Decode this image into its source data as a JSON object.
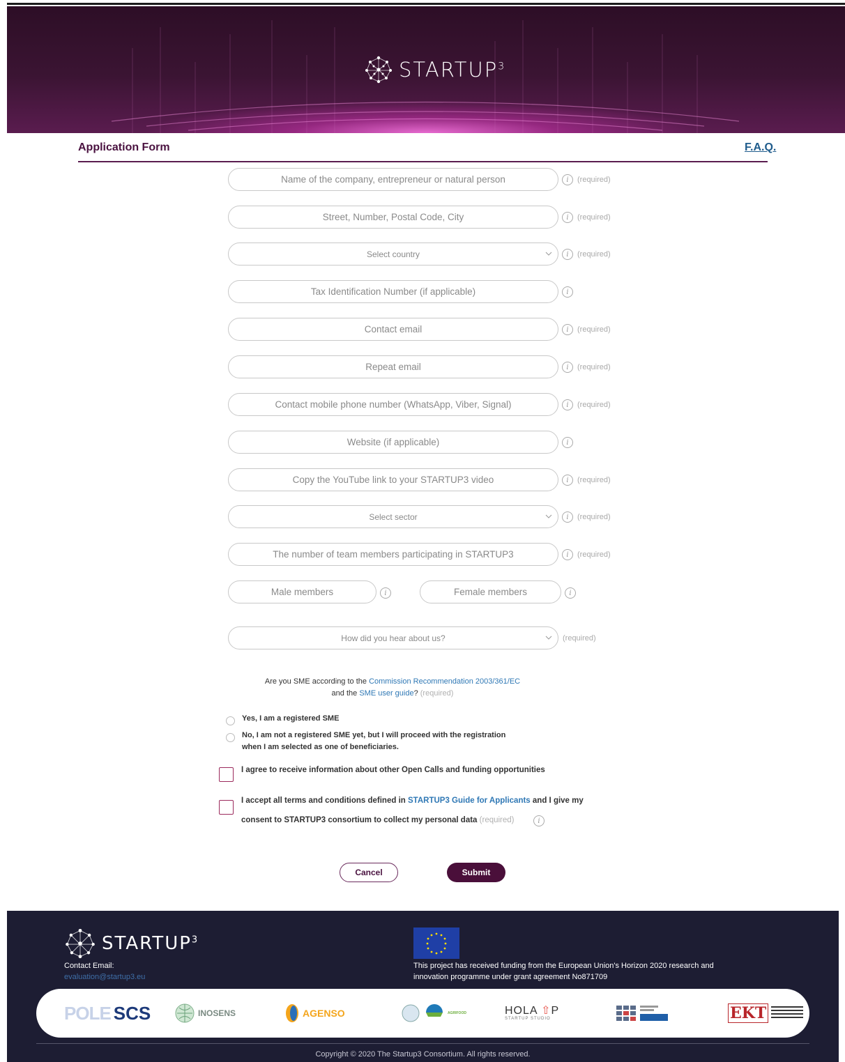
{
  "hero": {
    "brand": "STARTUP",
    "brand_sup": "3"
  },
  "header": {
    "title": "Application Form",
    "faq": "F.A.Q."
  },
  "fields": {
    "company": {
      "placeholder": "Name of the company, entrepreneur or natural person",
      "required": "(required)"
    },
    "address": {
      "placeholder": "Street, Number, Postal Code, City",
      "required": "(required)"
    },
    "country": {
      "placeholder": "Select country",
      "required": "(required)"
    },
    "tax": {
      "placeholder": "Tax Identification Number (if applicable)"
    },
    "email": {
      "placeholder": "Contact email",
      "required": "(required)"
    },
    "repeat_email": {
      "placeholder": "Repeat email",
      "required": "(required)"
    },
    "phone": {
      "placeholder": "Contact mobile phone number (WhatsApp, Viber, Signal)",
      "required": "(required)"
    },
    "website": {
      "placeholder": "Website (if applicable)"
    },
    "youtube": {
      "placeholder": "Copy the YouTube link to your STARTUP3 video",
      "required": "(required)"
    },
    "sector": {
      "placeholder": "Select sector",
      "required": "(required)"
    },
    "team": {
      "placeholder": "The number of team members participating in STARTUP3",
      "required": "(required)"
    },
    "male": {
      "placeholder": "Male members"
    },
    "female": {
      "placeholder": "Female members"
    },
    "hear": {
      "placeholder": "How did you hear about us?",
      "required": "(required)"
    }
  },
  "info_glyph": "i",
  "sme": {
    "q_prefix": "Are you SME according to the ",
    "q_link1": "Commission Recommendation 2003/361/EC",
    "q_mid": " and the ",
    "q_link2": "SME user guide",
    "q_suffix": "? ",
    "q_required": "(required)",
    "opt_yes": "Yes, I am a registered SME",
    "opt_no_line1": "No, I am not a registered SME yet, but I will proceed with the registration",
    "opt_no_line2": "when I am selected as one of beneficiaries."
  },
  "consent": {
    "newsletter": "I agree to receive information about other Open Calls and funding opportunities",
    "terms_prefix": "I accept all terms and conditions defined in ",
    "terms_link": "STARTUP3 Guide for Applicants",
    "terms_suffix": " and I give my",
    "terms_line2": "consent to STARTUP3 consortium to collect my personal data",
    "terms_required": "(required)"
  },
  "buttons": {
    "cancel": "Cancel",
    "submit": "Submit"
  },
  "footer": {
    "brand": "STARTUP",
    "brand_sup": "3",
    "contact_label": "Contact Email:",
    "contact_email": "evaluation@startup3.eu",
    "eu_text_line1": "This project has received funding from the European Union's Horizon 2020 research and",
    "eu_text_line2": "innovation programme under grant agreement No871709",
    "partners": [
      "POLE",
      "SCS",
      "INOSENS",
      "AGENSO",
      "AGRIFOOD",
      "HOLA",
      "P",
      "STARTUP STUDIO",
      "EKT"
    ],
    "copyright": "Copyright © 2020 The Startup3 Consortium. All rights reserved."
  },
  "colors": {
    "brand_purple": "#4a0f3a",
    "link_blue": "#2f78b5",
    "footer_bg": "#1d1d33"
  }
}
